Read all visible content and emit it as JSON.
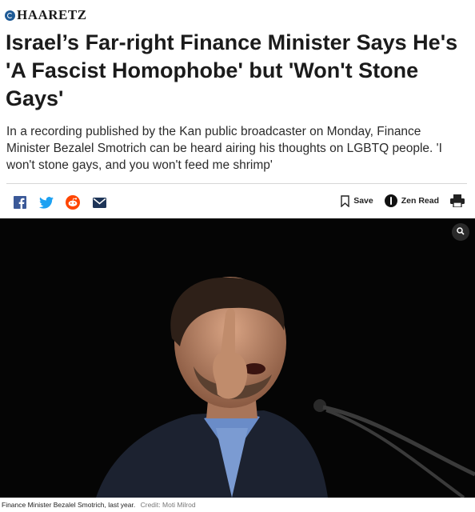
{
  "brand": {
    "name": "HAARETZ"
  },
  "article": {
    "headline": "Israel’s Far-right Finance Minister Says He's 'A Fascist Homophobe' but 'Won't Stone Gays'",
    "dek": "In a recording published by the Kan public broadcaster on Monday, Finance Minister Bezalel Smotrich can be heard airing his thoughts on LGBTQ people. 'I won't stone gays, and you won't feed me shrimp'"
  },
  "share": {
    "icons": [
      "facebook-icon",
      "twitter-icon",
      "reddit-icon",
      "email-icon"
    ]
  },
  "tools": {
    "save_label": "Save",
    "zen_label": "Zen Read",
    "print_icon": "printer-icon"
  },
  "image": {
    "caption": "Finance Minister Bezalel Smotrich, last year.",
    "credit": "Credit: Moti Milrod",
    "zoom_icon": "magnifier-icon"
  },
  "colors": {
    "brand_blue": "#1e5a96",
    "facebook": "#3b5998",
    "twitter": "#1da1f2",
    "reddit": "#ff4500",
    "text": "#1b1b1b"
  }
}
